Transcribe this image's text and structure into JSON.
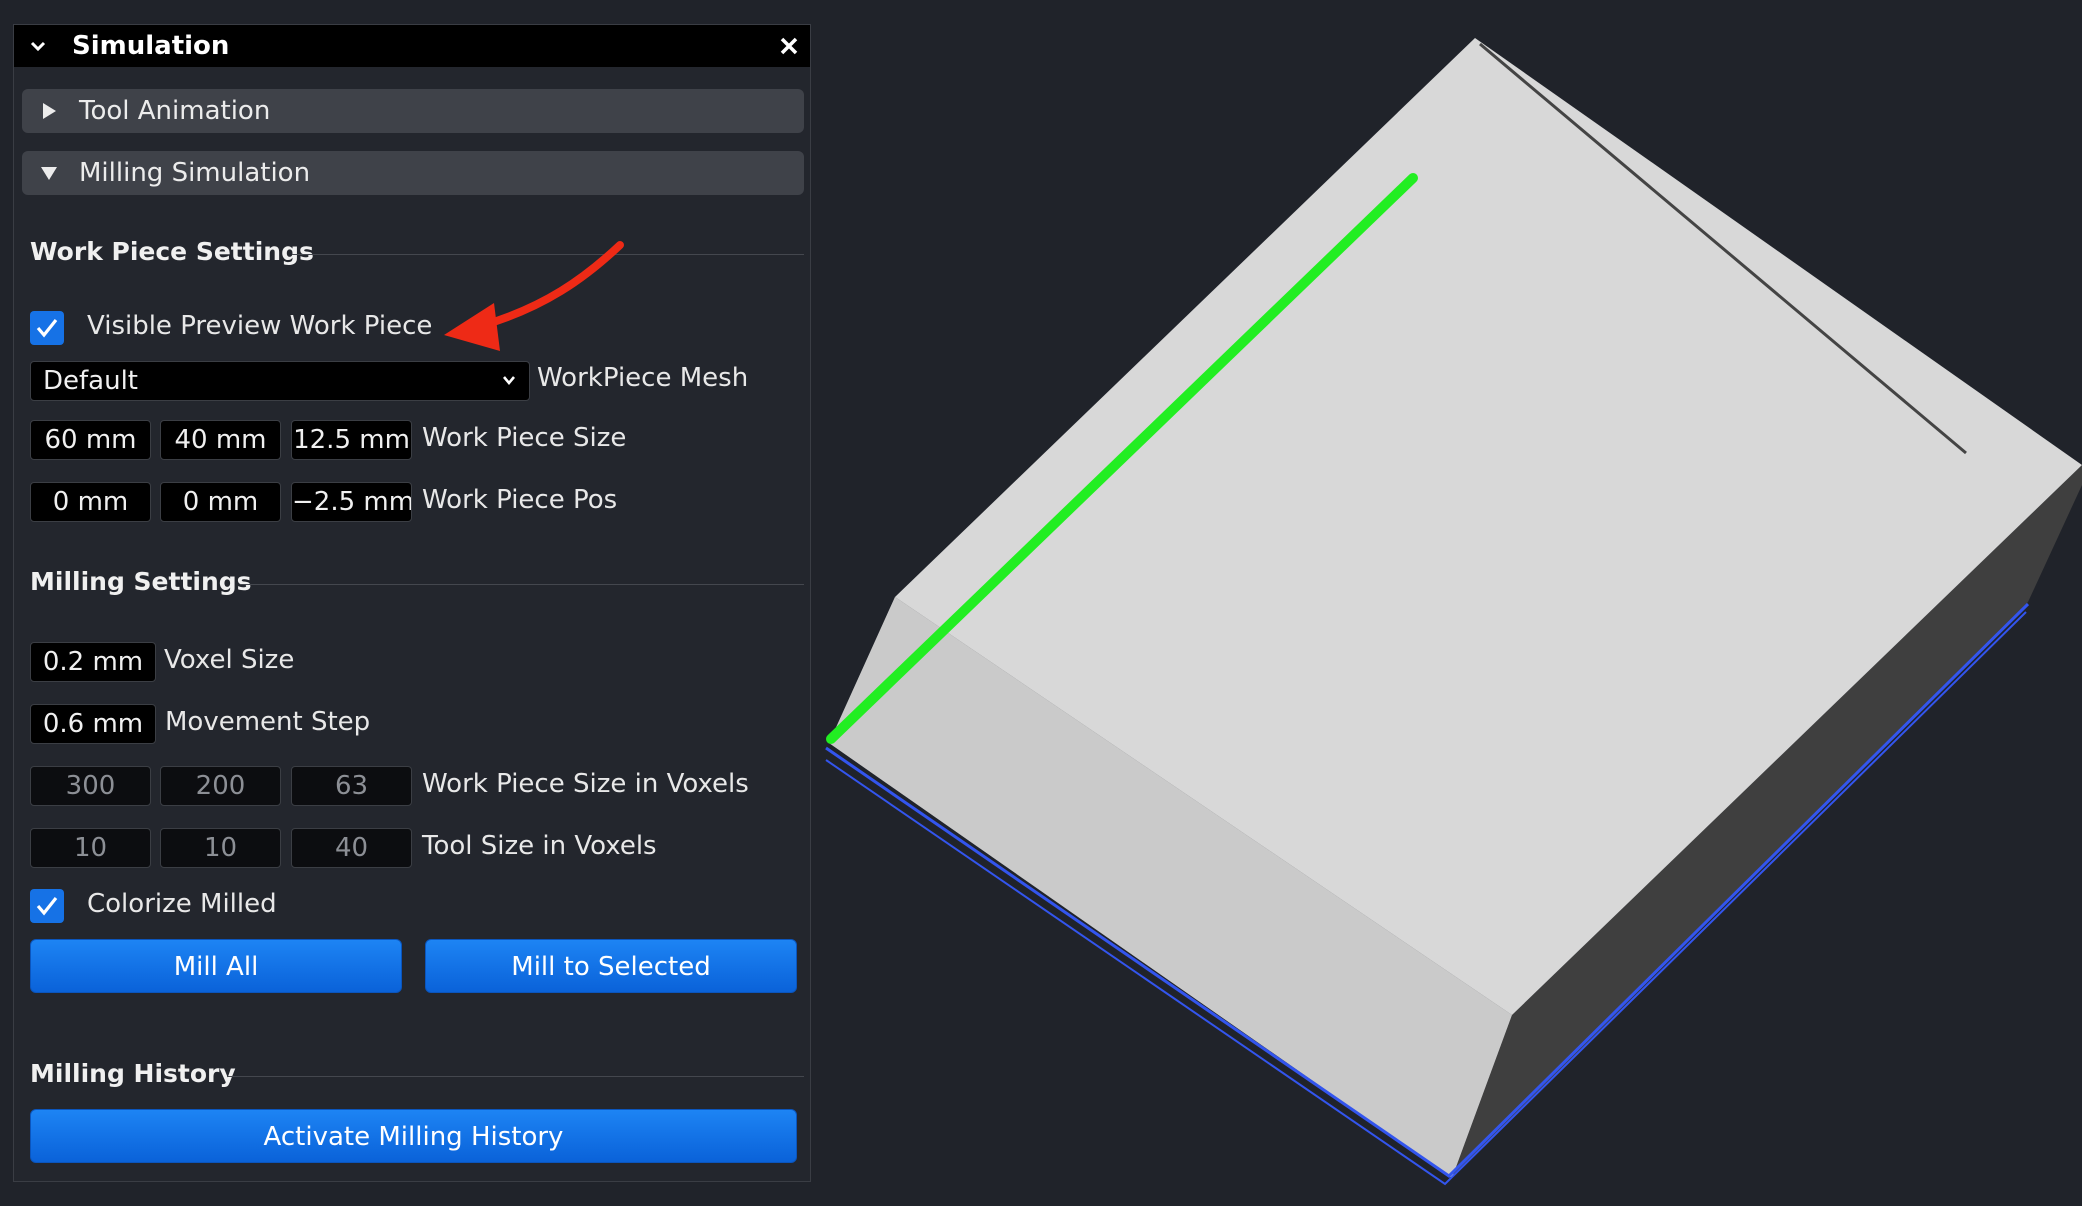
{
  "window": {
    "title": "Simulation"
  },
  "panels": {
    "tool_animation": "Tool Animation",
    "milling_simulation": "Milling Simulation"
  },
  "workpiece_settings": {
    "heading": "Work Piece Settings",
    "visible_preview": {
      "label": "Visible Preview Work Piece",
      "checked": true
    },
    "mesh": {
      "selected": "Default",
      "label": "WorkPiece Mesh"
    },
    "size": {
      "values": [
        "60 mm",
        "40 mm",
        "12.5 mm"
      ],
      "label": "Work Piece Size"
    },
    "pos": {
      "values": [
        "0 mm",
        "0 mm",
        "−2.5 mm"
      ],
      "label": "Work Piece Pos"
    }
  },
  "milling_settings": {
    "heading": "Milling Settings",
    "voxel_size": {
      "value": "0.2 mm",
      "label": "Voxel Size"
    },
    "movement_step": {
      "value": "0.6 mm",
      "label": "Movement Step"
    },
    "size_voxels": {
      "values": [
        "300",
        "200",
        "63"
      ],
      "label": "Work Piece Size in Voxels"
    },
    "tool_voxels": {
      "values": [
        "10",
        "10",
        "40"
      ],
      "label": "Tool Size in Voxels"
    },
    "colorize": {
      "label": "Colorize Milled",
      "checked": true
    },
    "mill_all": "Mill All",
    "mill_to_selected": "Mill to Selected"
  },
  "milling_history": {
    "heading": "Milling History",
    "activate": "Activate Milling History"
  },
  "colors": {
    "accent": "#1672e6",
    "background": "#20232a",
    "toolpath": "#22ee22",
    "edge_highlight": "#3355ee",
    "annotation_arrow": "#ee2a16"
  }
}
